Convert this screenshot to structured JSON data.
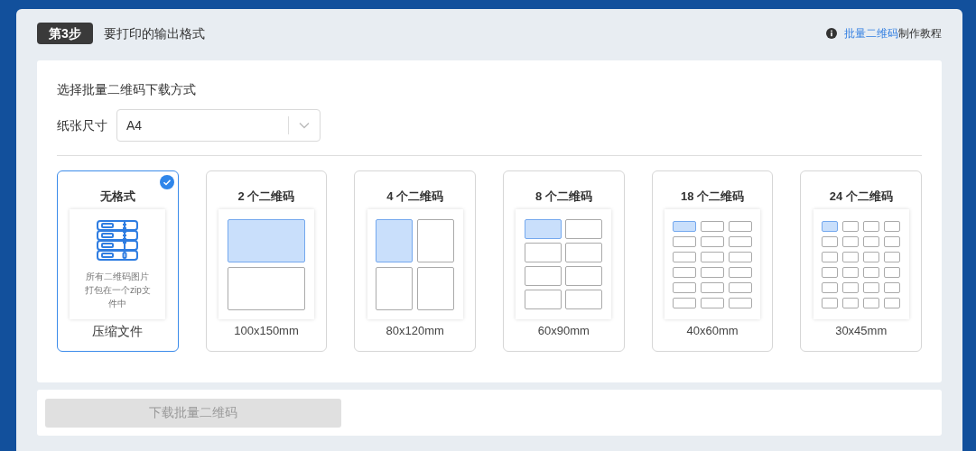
{
  "step": {
    "badge": "第3步",
    "title": "要打印的输出格式"
  },
  "help": {
    "link": "批量二维码",
    "text": "制作教程"
  },
  "section_title": "选择批量二维码下载方式",
  "paper_size": {
    "label": "纸张尺寸",
    "value": "A4"
  },
  "options": [
    {
      "title": "无格式",
      "kind": "zip",
      "note": "所有二维码图片打包在一个zip文件中",
      "size": "压缩文件",
      "selected": true
    },
    {
      "title": "2 个二维码",
      "kind": "g1x2",
      "size": "100x150mm",
      "selected": false
    },
    {
      "title": "4 个二维码",
      "kind": "g2x2",
      "size": "80x120mm",
      "selected": false
    },
    {
      "title": "8 个二维码",
      "kind": "g2x4",
      "size": "60x90mm",
      "selected": false
    },
    {
      "title": "18 个二维码",
      "kind": "g3x6",
      "size": "40x60mm",
      "selected": false
    },
    {
      "title": "24 个二维码",
      "kind": "g4x6",
      "size": "30x45mm",
      "selected": false
    }
  ],
  "download_button": {
    "label": "下载批量二维码",
    "disabled": true
  }
}
